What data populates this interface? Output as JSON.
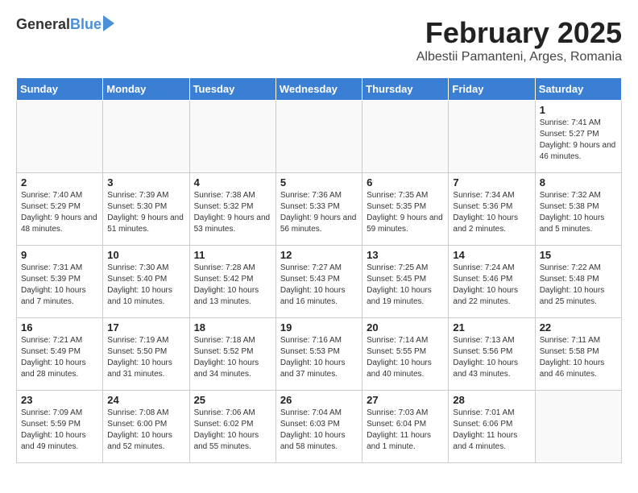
{
  "logo": {
    "general": "General",
    "blue": "Blue"
  },
  "title": "February 2025",
  "subtitle": "Albestii Pamanteni, Arges, Romania",
  "days_header": [
    "Sunday",
    "Monday",
    "Tuesday",
    "Wednesday",
    "Thursday",
    "Friday",
    "Saturday"
  ],
  "weeks": [
    [
      {
        "day": "",
        "info": ""
      },
      {
        "day": "",
        "info": ""
      },
      {
        "day": "",
        "info": ""
      },
      {
        "day": "",
        "info": ""
      },
      {
        "day": "",
        "info": ""
      },
      {
        "day": "",
        "info": ""
      },
      {
        "day": "1",
        "info": "Sunrise: 7:41 AM\nSunset: 5:27 PM\nDaylight: 9 hours and 46 minutes."
      }
    ],
    [
      {
        "day": "2",
        "info": "Sunrise: 7:40 AM\nSunset: 5:29 PM\nDaylight: 9 hours and 48 minutes."
      },
      {
        "day": "3",
        "info": "Sunrise: 7:39 AM\nSunset: 5:30 PM\nDaylight: 9 hours and 51 minutes."
      },
      {
        "day": "4",
        "info": "Sunrise: 7:38 AM\nSunset: 5:32 PM\nDaylight: 9 hours and 53 minutes."
      },
      {
        "day": "5",
        "info": "Sunrise: 7:36 AM\nSunset: 5:33 PM\nDaylight: 9 hours and 56 minutes."
      },
      {
        "day": "6",
        "info": "Sunrise: 7:35 AM\nSunset: 5:35 PM\nDaylight: 9 hours and 59 minutes."
      },
      {
        "day": "7",
        "info": "Sunrise: 7:34 AM\nSunset: 5:36 PM\nDaylight: 10 hours and 2 minutes."
      },
      {
        "day": "8",
        "info": "Sunrise: 7:32 AM\nSunset: 5:38 PM\nDaylight: 10 hours and 5 minutes."
      }
    ],
    [
      {
        "day": "9",
        "info": "Sunrise: 7:31 AM\nSunset: 5:39 PM\nDaylight: 10 hours and 7 minutes."
      },
      {
        "day": "10",
        "info": "Sunrise: 7:30 AM\nSunset: 5:40 PM\nDaylight: 10 hours and 10 minutes."
      },
      {
        "day": "11",
        "info": "Sunrise: 7:28 AM\nSunset: 5:42 PM\nDaylight: 10 hours and 13 minutes."
      },
      {
        "day": "12",
        "info": "Sunrise: 7:27 AM\nSunset: 5:43 PM\nDaylight: 10 hours and 16 minutes."
      },
      {
        "day": "13",
        "info": "Sunrise: 7:25 AM\nSunset: 5:45 PM\nDaylight: 10 hours and 19 minutes."
      },
      {
        "day": "14",
        "info": "Sunrise: 7:24 AM\nSunset: 5:46 PM\nDaylight: 10 hours and 22 minutes."
      },
      {
        "day": "15",
        "info": "Sunrise: 7:22 AM\nSunset: 5:48 PM\nDaylight: 10 hours and 25 minutes."
      }
    ],
    [
      {
        "day": "16",
        "info": "Sunrise: 7:21 AM\nSunset: 5:49 PM\nDaylight: 10 hours and 28 minutes."
      },
      {
        "day": "17",
        "info": "Sunrise: 7:19 AM\nSunset: 5:50 PM\nDaylight: 10 hours and 31 minutes."
      },
      {
        "day": "18",
        "info": "Sunrise: 7:18 AM\nSunset: 5:52 PM\nDaylight: 10 hours and 34 minutes."
      },
      {
        "day": "19",
        "info": "Sunrise: 7:16 AM\nSunset: 5:53 PM\nDaylight: 10 hours and 37 minutes."
      },
      {
        "day": "20",
        "info": "Sunrise: 7:14 AM\nSunset: 5:55 PM\nDaylight: 10 hours and 40 minutes."
      },
      {
        "day": "21",
        "info": "Sunrise: 7:13 AM\nSunset: 5:56 PM\nDaylight: 10 hours and 43 minutes."
      },
      {
        "day": "22",
        "info": "Sunrise: 7:11 AM\nSunset: 5:58 PM\nDaylight: 10 hours and 46 minutes."
      }
    ],
    [
      {
        "day": "23",
        "info": "Sunrise: 7:09 AM\nSunset: 5:59 PM\nDaylight: 10 hours and 49 minutes."
      },
      {
        "day": "24",
        "info": "Sunrise: 7:08 AM\nSunset: 6:00 PM\nDaylight: 10 hours and 52 minutes."
      },
      {
        "day": "25",
        "info": "Sunrise: 7:06 AM\nSunset: 6:02 PM\nDaylight: 10 hours and 55 minutes."
      },
      {
        "day": "26",
        "info": "Sunrise: 7:04 AM\nSunset: 6:03 PM\nDaylight: 10 hours and 58 minutes."
      },
      {
        "day": "27",
        "info": "Sunrise: 7:03 AM\nSunset: 6:04 PM\nDaylight: 11 hours and 1 minute."
      },
      {
        "day": "28",
        "info": "Sunrise: 7:01 AM\nSunset: 6:06 PM\nDaylight: 11 hours and 4 minutes."
      },
      {
        "day": "",
        "info": ""
      }
    ]
  ]
}
